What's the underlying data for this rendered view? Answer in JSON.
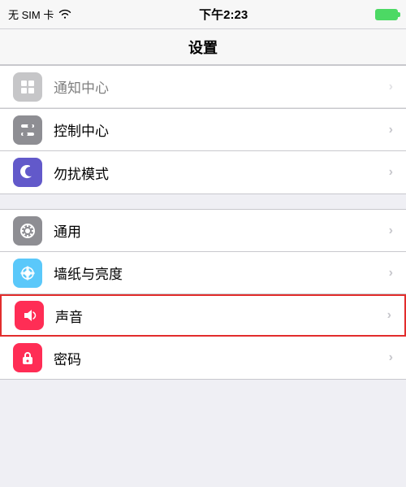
{
  "statusBar": {
    "carrier": "无 SIM 卡",
    "wifi": "wifi",
    "time": "下午2:23",
    "battery": "full"
  },
  "navBar": {
    "title": "设置"
  },
  "sections": [
    {
      "id": "top-partial",
      "items": [
        {
          "id": "notification-center",
          "label": "通知中心",
          "iconType": "notification",
          "iconBg": "gray",
          "partial": true
        }
      ]
    },
    {
      "id": "section1",
      "items": [
        {
          "id": "control-center",
          "label": "控制中心",
          "iconType": "control",
          "iconBg": "gray"
        },
        {
          "id": "do-not-disturb",
          "label": "勿扰模式",
          "iconType": "moon",
          "iconBg": "purple"
        }
      ]
    },
    {
      "id": "section2",
      "items": [
        {
          "id": "general",
          "label": "通用",
          "iconType": "gear",
          "iconBg": "gray"
        },
        {
          "id": "wallpaper",
          "label": "墙纸与亮度",
          "iconType": "wallpaper",
          "iconBg": "teal"
        },
        {
          "id": "sounds",
          "label": "声音",
          "iconType": "sound",
          "iconBg": "pink",
          "highlighted": true
        },
        {
          "id": "passcode",
          "label": "密码",
          "iconType": "lock",
          "iconBg": "pink"
        }
      ]
    }
  ],
  "chevron": "›",
  "labels": {
    "carrier_nosim": "无 SIM 卡",
    "time": "下午2:23"
  }
}
